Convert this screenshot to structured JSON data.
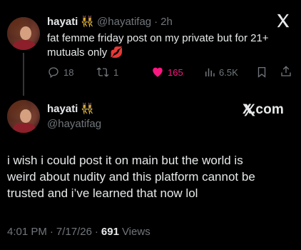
{
  "tweet1": {
    "name": "hayati",
    "handle": "@hayatifag",
    "separator": "·",
    "time": "2h",
    "text_line1": "fat femme friday post on my private but for 21+",
    "text_line2": "mutuals only",
    "text_emoji": "💋",
    "name_emoji": "👯‍♀️",
    "metrics": {
      "replies": "18",
      "retweets": "1",
      "likes": "165",
      "views": "6.5K"
    }
  },
  "tweet2": {
    "name": "hayati",
    "name_emoji": "👯‍♀️",
    "handle": "@hayatifag",
    "brand": "X.com",
    "text_line1": "i wish i could post it on main but the world is",
    "text_line2": "weird about nudity and this platform cannot be",
    "text_line3": "trusted and i’ve learned that now lol",
    "time": "4:01 PM",
    "date": "7/17/26",
    "separator": "·",
    "views_count": "691",
    "views_label": "Views"
  },
  "colors": {
    "background": "#000000",
    "text": "#e7e9ea",
    "muted": "#71767b",
    "like": "#f91880"
  },
  "icons": {
    "reply": "reply-icon",
    "retweet": "retweet-icon",
    "like": "heart-icon",
    "views": "views-icon",
    "bookmark": "bookmark-icon",
    "share": "share-icon",
    "brand": "x-logo-icon"
  }
}
